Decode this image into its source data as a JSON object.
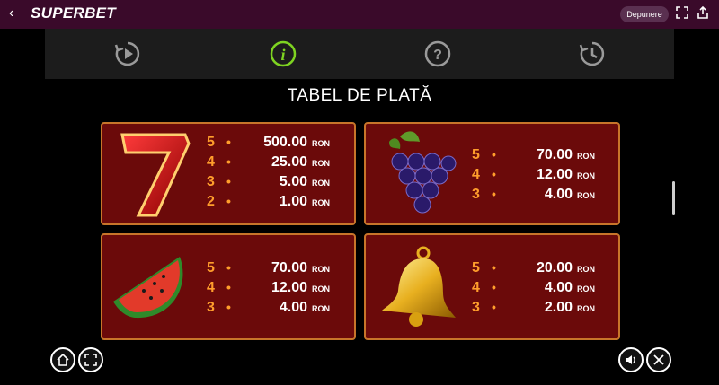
{
  "app": {
    "brand": "SUPERBET",
    "deposit_label": "Depunere"
  },
  "paytable": {
    "title": "TABEL DE PLATĂ",
    "currency": "RON",
    "symbols": [
      {
        "symbol": "seven-icon",
        "payouts": [
          {
            "count": "5",
            "amount": "500.00"
          },
          {
            "count": "4",
            "amount": "25.00"
          },
          {
            "count": "3",
            "amount": "5.00"
          },
          {
            "count": "2",
            "amount": "1.00"
          }
        ]
      },
      {
        "symbol": "grapes-icon",
        "payouts": [
          {
            "count": "5",
            "amount": "70.00"
          },
          {
            "count": "4",
            "amount": "12.00"
          },
          {
            "count": "3",
            "amount": "4.00"
          }
        ]
      },
      {
        "symbol": "watermelon-icon",
        "payouts": [
          {
            "count": "5",
            "amount": "70.00"
          },
          {
            "count": "4",
            "amount": "12.00"
          },
          {
            "count": "3",
            "amount": "4.00"
          }
        ]
      },
      {
        "symbol": "bell-icon",
        "payouts": [
          {
            "count": "5",
            "amount": "20.00"
          },
          {
            "count": "4",
            "amount": "4.00"
          },
          {
            "count": "3",
            "amount": "2.00"
          }
        ]
      }
    ]
  },
  "game_nav": [
    {
      "icon": "replay-icon"
    },
    {
      "icon": "info-icon",
      "active_color": "#7ed321"
    },
    {
      "icon": "help-icon"
    },
    {
      "icon": "history-icon"
    }
  ],
  "colors": {
    "topbar": "#3a0a2a",
    "panel": "#6b0a0a",
    "border": "#c8752a",
    "count": "#ff9e2c"
  }
}
